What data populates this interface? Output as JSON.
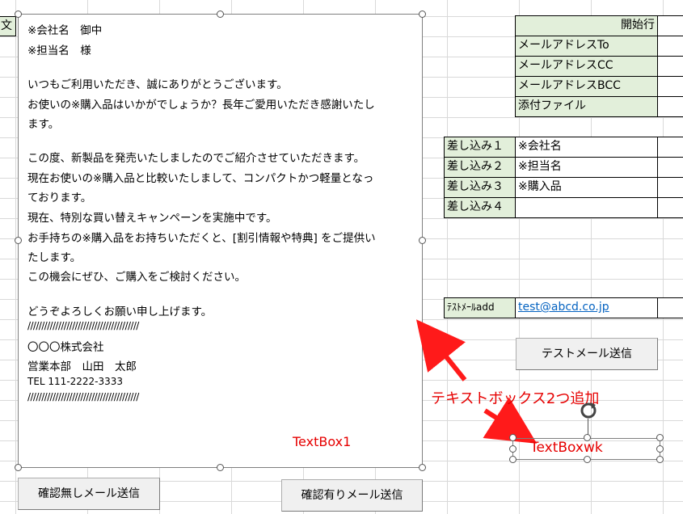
{
  "sheet": {
    "left_partial_cell": "文",
    "config_rows": [
      {
        "label": "開始行",
        "align": "right"
      },
      {
        "label": "メールアドレスTo",
        "align": "left"
      },
      {
        "label": "メールアドレスCC",
        "align": "left"
      },
      {
        "label": "メールアドレスBCC",
        "align": "left"
      },
      {
        "label": "添付ファイル",
        "align": "left"
      }
    ],
    "merge_rows": [
      {
        "label": "差し込み１",
        "value": "※会社名"
      },
      {
        "label": "差し込み２",
        "value": "※担当名"
      },
      {
        "label": "差し込み３",
        "value": "※購入品"
      },
      {
        "label": "差し込み４",
        "value": ""
      }
    ],
    "test_mail": {
      "label": "ﾃｽﾄﾒｰﾙadd",
      "value": "test@abcd.co.jp"
    },
    "test_send_button": "テストメール送信",
    "confirm_none_button": "確認無しメール送信",
    "confirm_with_button": "確認有りメール送信"
  },
  "textbox1": {
    "lines": [
      "※会社名　御中",
      "※担当名　様",
      "いつもご利用いただき、誠にありがとうございます。",
      "お使いの※購入品はいかがでしょうか？長年ご愛用いただき感謝いたし",
      "ます。",
      "この度、新製品を発売いたしましたのでご紹介させていただきます。",
      "現在お使いの※購入品と比較いたしまして、コンパクトかつ軽量となっ",
      "ております。",
      "現在、特別な買い替えキャンペーンを実施中です。",
      "お手持ちの※購入品をお持ちいただくと、[割引情報や特典] をご提供い",
      "たします。",
      "この機会にぜひ、ご購入をご検討ください。",
      "どうぞよろしくお願い申し上げます。",
      "////////////////////////////////////////",
      "〇〇〇株式会社",
      "営業本部　山田　太郎",
      "TEL 111-2222-3333",
      "////////////////////////////////////////"
    ],
    "name_label": "TextBox1"
  },
  "annotation": {
    "caption": "テキストボックス2つ追加",
    "textbox_wk_label": "TextBoxwk",
    "color": "#e60000"
  }
}
